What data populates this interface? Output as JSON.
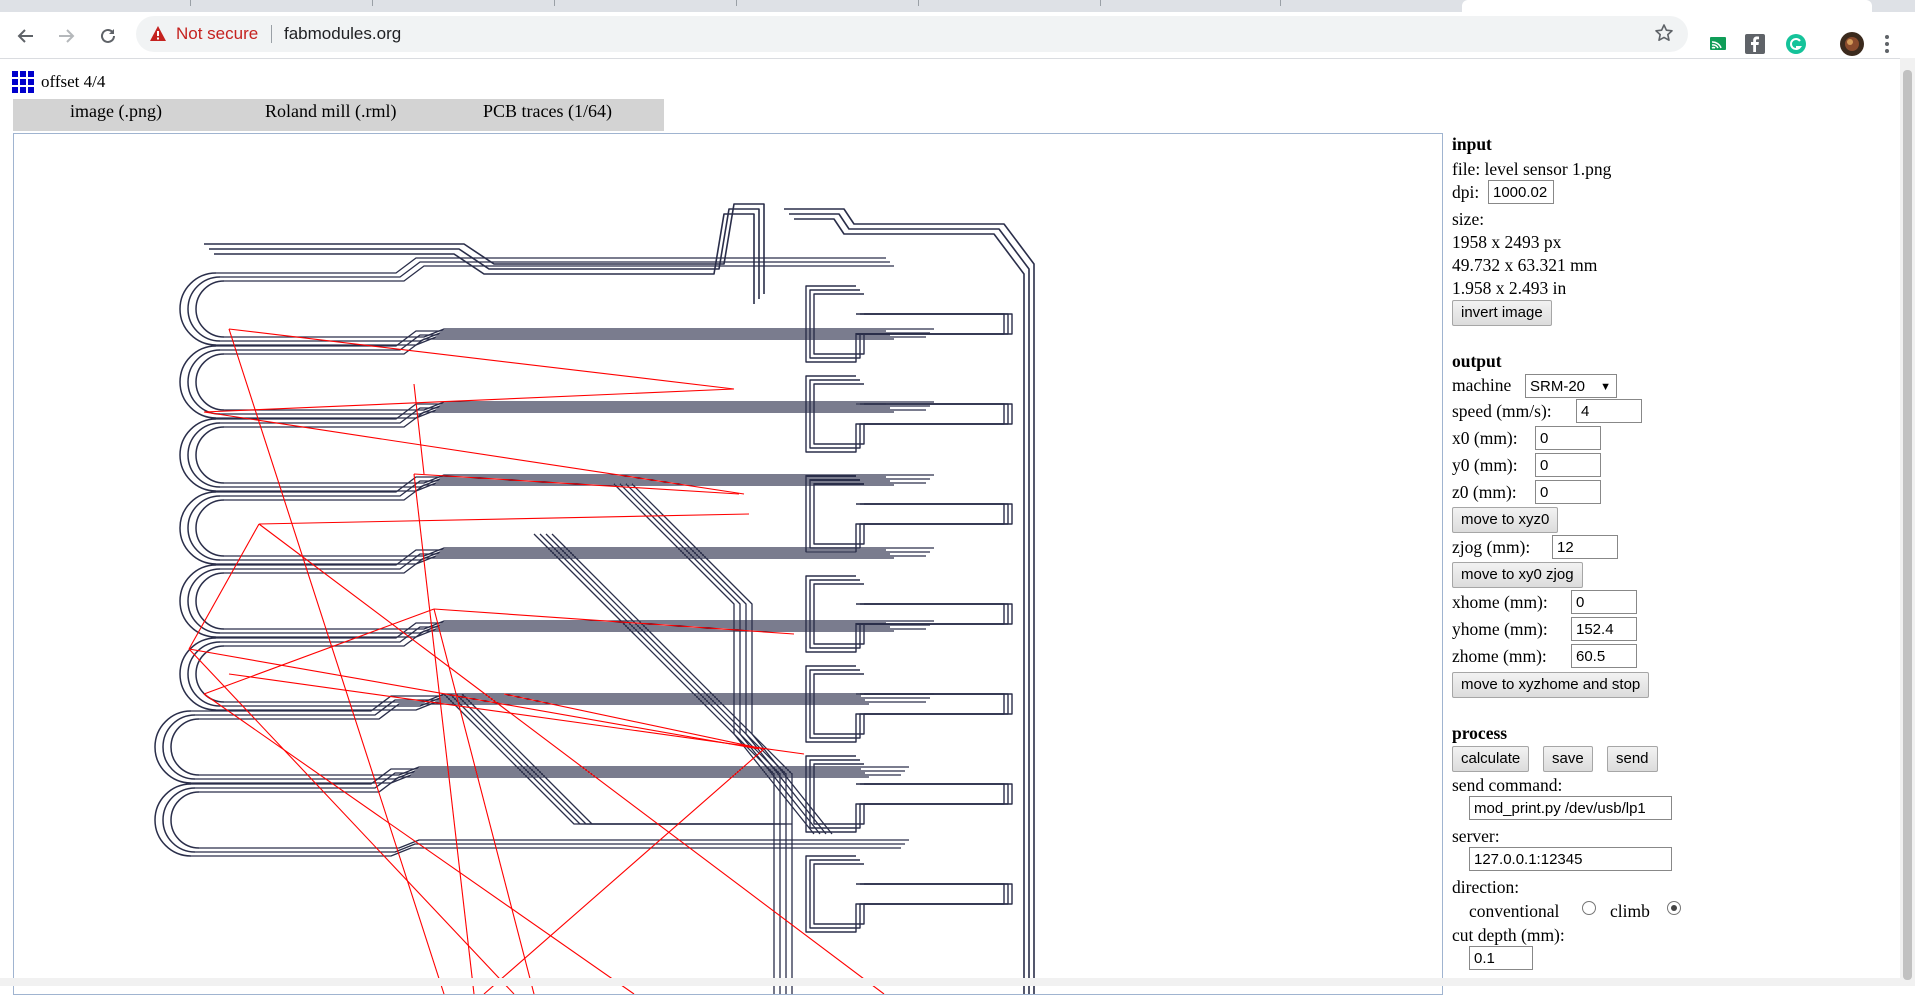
{
  "browser": {
    "security_label": "Not secure",
    "url": "fabmodules.org"
  },
  "app": {
    "title": "offset 4/4"
  },
  "tabs": [
    {
      "label": "image (.png)"
    },
    {
      "label": "Roland mill (.rml)"
    },
    {
      "label": "PCB traces (1/64)"
    }
  ],
  "input": {
    "heading": "input",
    "file_label": "file: level sensor 1.png",
    "dpi_label": "dpi:",
    "dpi_value": "1000.02",
    "size_label": "size:",
    "size_px": "1958 x 2493 px",
    "size_mm": "49.732 x 63.321 mm",
    "size_in": "1.958 x 2.493 in",
    "invert_button": "invert image"
  },
  "output": {
    "heading": "output",
    "machine_label": "machine",
    "machine_value": "SRM-20",
    "speed_label": "speed (mm/s):",
    "speed_value": "4",
    "x0_label": "x0 (mm):",
    "x0_value": "0",
    "y0_label": "y0 (mm):",
    "y0_value": "0",
    "z0_label": "z0 (mm):",
    "z0_value": "0",
    "move_xyz0_button": "move to xyz0",
    "zjog_label": "zjog (mm):",
    "zjog_value": "12",
    "move_xy0_zjog_button": "move to xy0 zjog",
    "xhome_label": "xhome (mm):",
    "xhome_value": "0",
    "yhome_label": "yhome (mm):",
    "yhome_value": "152.4",
    "zhome_label": "zhome (mm):",
    "zhome_value": "60.5",
    "move_home_button": "move to xyzhome and stop"
  },
  "process": {
    "heading": "process",
    "calculate_button": "calculate",
    "save_button": "save",
    "send_button": "send",
    "send_command_label": "send command:",
    "send_command_value": "mod_print.py /dev/usb/lp1",
    "server_label": "server:",
    "server_value": "127.0.0.1:12345",
    "direction_label": "direction:",
    "conventional_label": "conventional",
    "climb_label": "climb",
    "direction_selected": "climb",
    "cut_depth_label": "cut depth (mm):",
    "cut_depth_value": "0.1"
  },
  "colors": {
    "toolpath": "#2a2e4a",
    "rapid_move": "#ff0000",
    "logo": "#0000cc"
  },
  "icons": {
    "back": "arrow-left-icon",
    "forward": "arrow-right-icon",
    "reload": "reload-icon",
    "warning": "warning-triangle-icon",
    "bookmark": "star-icon",
    "menu": "kebab-menu-icon"
  }
}
